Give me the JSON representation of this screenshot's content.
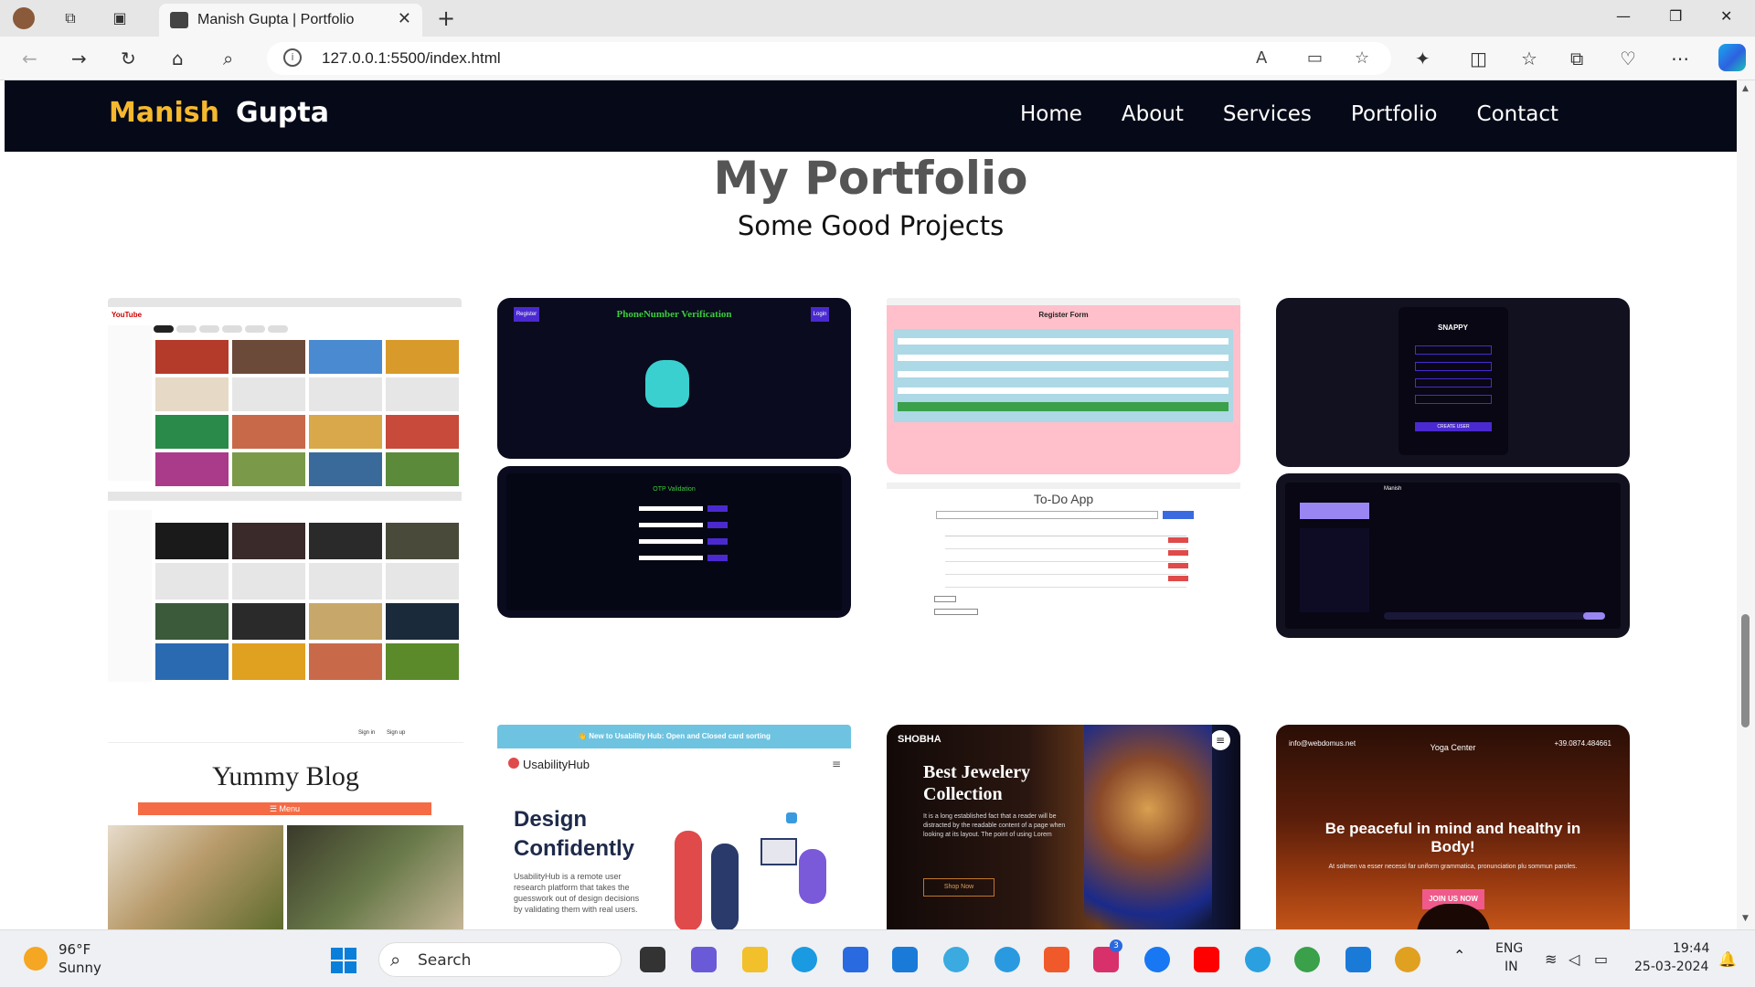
{
  "browser": {
    "tab_title": "Manish Gupta | Portfolio",
    "url": "127.0.0.1:5500/index.html"
  },
  "site": {
    "logo_first": "Manish",
    "logo_last": "Gupta",
    "nav": [
      "Home",
      "About",
      "Services",
      "Portfolio",
      "Contact"
    ],
    "section_title": "My Portfolio",
    "section_subtitle": "Some Good Projects",
    "projects": {
      "youtube_logo": "YouTube",
      "phone_title": "PhoneNumber Verification",
      "phone_register": "Register",
      "phone_login": "Login",
      "otp_title": "OTP Validation",
      "register_form_title": "Register Form",
      "todo_title": "To-Do App",
      "snappy_brand": "SNAPPY",
      "snappy_button": "CREATE USER",
      "snappy_user": "Manish",
      "blog_title": "Yummy Blog",
      "blog_menu": "☰ Menu",
      "blog_signin": "Sign in",
      "blog_signup": "Sign up",
      "usability_banner": "👋 New to Usability Hub: Open and Closed card sorting",
      "usability_brand": "UsabilityHub",
      "usability_heading_1": "Design",
      "usability_heading_2": "Confidently",
      "usability_body": "UsabilityHub is a remote user research platform that takes the guesswork out of design decisions by validating them with real users.",
      "jewel_brand": "SHOBHA",
      "jewel_heading": "Best Jewelery Collection",
      "jewel_body": "It is a long established fact that a reader will be distracted by the readable content of a page when looking at its layout. The point of using Lorem",
      "jewel_button": "Shop Now",
      "yoga_email": "info@webdomus.net",
      "yoga_phone": "+39.0874.484661",
      "yoga_brand": "Yoga Center",
      "yoga_heading": "Be peaceful in mind and healthy in Body!",
      "yoga_sub": "At solmen va esser necessi far uniform grammatica, pronunciation plu sommun paroles.",
      "yoga_button": "JOIN US NOW"
    }
  },
  "taskbar": {
    "temp": "96°F",
    "condition": "Sunny",
    "search_label": "Search",
    "notif_count": "3",
    "lang_1": "ENG",
    "lang_2": "IN",
    "time": "19:44",
    "date": "25-03-2024"
  }
}
